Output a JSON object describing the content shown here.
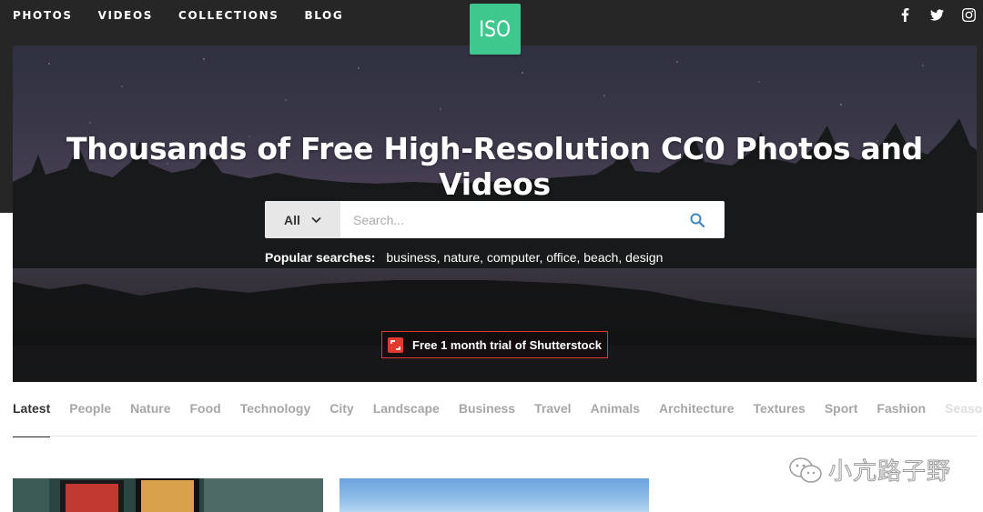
{
  "nav": {
    "links": [
      "PHOTOS",
      "VIDEOS",
      "COLLECTIONS",
      "BLOG"
    ],
    "logo_text": "ISO",
    "social_icons": [
      "facebook-icon",
      "twitter-icon",
      "instagram-icon"
    ]
  },
  "hero": {
    "title": "Thousands of Free High-Resolution CC0 Photos and Videos",
    "search": {
      "filter_label": "All",
      "placeholder": "Search..."
    },
    "popular": {
      "label": "Popular searches:",
      "terms": "business, nature, computer, office, beach, design"
    },
    "promo": {
      "text": "Free 1 month trial of Shutterstock"
    }
  },
  "tabs": [
    "Latest",
    "People",
    "Nature",
    "Food",
    "Technology",
    "City",
    "Landscape",
    "Business",
    "Travel",
    "Animals",
    "Architecture",
    "Textures",
    "Sport",
    "Fashion",
    "Season"
  ],
  "watermark": {
    "text": "小亢路子野"
  },
  "colors": {
    "brand": "#3ec88d",
    "promo_red": "#e13b30",
    "header_bg": "#262626"
  }
}
